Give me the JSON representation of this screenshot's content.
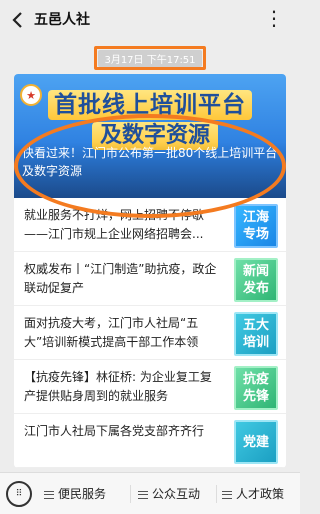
{
  "header": {
    "title": "五邑人社",
    "more_icon": "more-icon",
    "back_icon": "back-chevron-icon"
  },
  "timestamp": "3月17日 下午17:51",
  "banner": {
    "line1": "首批线上培训平台",
    "line2": "及数字资源",
    "headline": "快看过来！江门市公布第一批80个线上培训平台及数字资源"
  },
  "articles": [
    {
      "title": "就业服务不打烊，网上招聘不停歇——江门市规上企业网络招聘会...",
      "thumb": "江海 专场"
    },
    {
      "title": "权威发布丨“江门制造”助抗疫，政企联动促复产",
      "thumb": "新闻 发布"
    },
    {
      "title": "面对抗疫大考，江门市人社局“五大”培训新模式提高干部工作本领",
      "thumb": "五大 培训"
    },
    {
      "title": "【抗疫先锋】林征桥: 为企业复工复产提供贴身周到的就业服务",
      "thumb": "抗疫 先锋"
    },
    {
      "title": "江门市人社局下属各党支部齐齐行",
      "thumb": "党建"
    }
  ],
  "bottom_menu": [
    {
      "label": "便民服务"
    },
    {
      "label": "公众互动"
    },
    {
      "label": "人才政策"
    }
  ],
  "colors": {
    "highlight": "#f47b20",
    "accent": "#2d7fe0"
  }
}
